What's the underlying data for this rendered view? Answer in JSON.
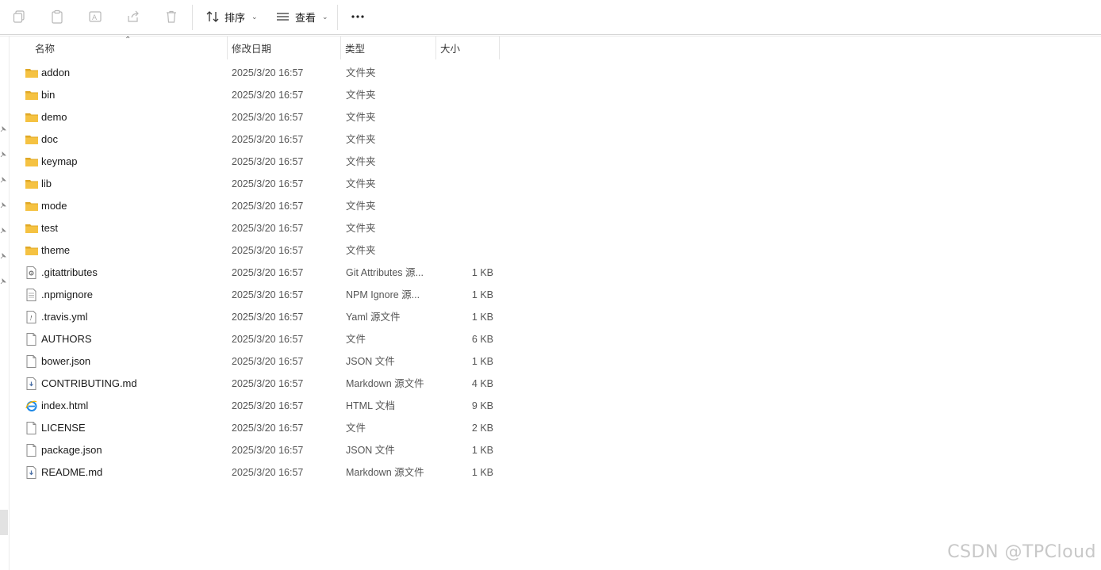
{
  "toolbar": {
    "copy_icon": "copy-icon",
    "paste_icon": "paste-icon",
    "rename_icon": "rename-icon",
    "share_icon": "share-icon",
    "delete_icon": "trash-icon",
    "sort_label": "排序",
    "view_label": "查看",
    "more_label": "···"
  },
  "columns": {
    "name": "名称",
    "date": "修改日期",
    "type": "类型",
    "size": "大小"
  },
  "files": [
    {
      "name": "addon",
      "date": "2025/3/20 16:57",
      "type": "文件夹",
      "size": "",
      "icon": "folder-icon"
    },
    {
      "name": "bin",
      "date": "2025/3/20 16:57",
      "type": "文件夹",
      "size": "",
      "icon": "folder-icon"
    },
    {
      "name": "demo",
      "date": "2025/3/20 16:57",
      "type": "文件夹",
      "size": "",
      "icon": "folder-icon"
    },
    {
      "name": "doc",
      "date": "2025/3/20 16:57",
      "type": "文件夹",
      "size": "",
      "icon": "folder-icon"
    },
    {
      "name": "keymap",
      "date": "2025/3/20 16:57",
      "type": "文件夹",
      "size": "",
      "icon": "folder-icon"
    },
    {
      "name": "lib",
      "date": "2025/3/20 16:57",
      "type": "文件夹",
      "size": "",
      "icon": "folder-icon"
    },
    {
      "name": "mode",
      "date": "2025/3/20 16:57",
      "type": "文件夹",
      "size": "",
      "icon": "folder-icon"
    },
    {
      "name": "test",
      "date": "2025/3/20 16:57",
      "type": "文件夹",
      "size": "",
      "icon": "folder-icon"
    },
    {
      "name": "theme",
      "date": "2025/3/20 16:57",
      "type": "文件夹",
      "size": "",
      "icon": "folder-icon"
    },
    {
      "name": ".gitattributes",
      "date": "2025/3/20 16:57",
      "type": "Git Attributes 源...",
      "size": "1 KB",
      "icon": "gear-file-icon"
    },
    {
      "name": ".npmignore",
      "date": "2025/3/20 16:57",
      "type": "NPM Ignore 源...",
      "size": "1 KB",
      "icon": "text-file-icon"
    },
    {
      "name": ".travis.yml",
      "date": "2025/3/20 16:57",
      "type": "Yaml 源文件",
      "size": "1 KB",
      "icon": "yaml-file-icon"
    },
    {
      "name": "AUTHORS",
      "date": "2025/3/20 16:57",
      "type": "文件",
      "size": "6 KB",
      "icon": "blank-file-icon"
    },
    {
      "name": "bower.json",
      "date": "2025/3/20 16:57",
      "type": "JSON 文件",
      "size": "1 KB",
      "icon": "blank-file-icon"
    },
    {
      "name": "CONTRIBUTING.md",
      "date": "2025/3/20 16:57",
      "type": "Markdown 源文件",
      "size": "4 KB",
      "icon": "markdown-file-icon"
    },
    {
      "name": "index.html",
      "date": "2025/3/20 16:57",
      "type": "HTML 文档",
      "size": "9 KB",
      "icon": "ie-html-icon"
    },
    {
      "name": "LICENSE",
      "date": "2025/3/20 16:57",
      "type": "文件",
      "size": "2 KB",
      "icon": "blank-file-icon"
    },
    {
      "name": "package.json",
      "date": "2025/3/20 16:57",
      "type": "JSON 文件",
      "size": "1 KB",
      "icon": "blank-file-icon"
    },
    {
      "name": "README.md",
      "date": "2025/3/20 16:57",
      "type": "Markdown 源文件",
      "size": "1 KB",
      "icon": "markdown-file-icon"
    }
  ],
  "watermark": "CSDN @TPCloud",
  "colors": {
    "folder": "#f5c242",
    "folder_dark": "#e0a826",
    "accent": "#0067c0"
  }
}
